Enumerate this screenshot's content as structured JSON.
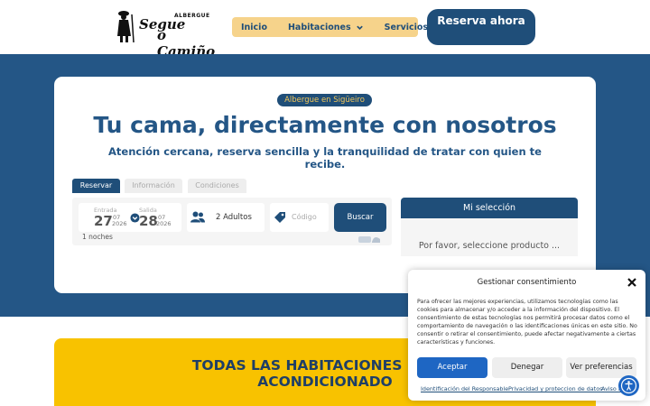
{
  "header": {
    "logo_line1": "Segue",
    "logo_small": "ALBERGUE",
    "logo_line2": "o Camiño",
    "nav": [
      {
        "label": "Inicio"
      },
      {
        "label": "Habitaciones"
      },
      {
        "label": "Servicios"
      }
    ],
    "reserve_button": "Reserva ahora"
  },
  "hero": {
    "badge": "Albergue en Sigüeiro",
    "title": "Tu cama, directamente con nosotros",
    "subtitle": "Atención cercana, reserva sencilla y la tranquilidad de tratar con quien te recibe."
  },
  "booking": {
    "tabs": [
      "Reservar",
      "Información",
      "Condiciones"
    ],
    "checkin": {
      "label": "Entrada",
      "day": "27",
      "month": "07",
      "year": "2026"
    },
    "checkout": {
      "label": "Salida",
      "day": "28",
      "month": "07",
      "year": "2026"
    },
    "guests": "2 Adultos",
    "code_placeholder": "Código",
    "search_button": "Buscar",
    "nights": "1 noches"
  },
  "selection": {
    "title": "Mi selección",
    "empty_text": "Por favor, seleccione producto ..."
  },
  "banner": {
    "line1": "TODAS LAS HABITACIONES DISPO",
    "line2": "ACONDICIONADO"
  },
  "cookie": {
    "title": "Gestionar consentimiento",
    "text": "Para ofrecer las mejores experiencias, utilizamos tecnologías como las cookies para almacenar y/o acceder a la información del dispositivo. El consentimiento de estas tecnologías nos permitirá procesar datos como el comportamiento de navegación o las identificaciones únicas en este sitio. No consentir o retirar el consentimiento, puede afectar negativamente a ciertas características y funciones.",
    "accept": "Aceptar",
    "deny": "Denegar",
    "preferences": "Ver preferencias",
    "links": [
      "Identificación del Responsable",
      "Privacidad y proteccion de datos",
      "Aviso le"
    ]
  },
  "colors": {
    "primary": "#1f4e79",
    "hero_band": "#245686",
    "nav_bg": "#f6d38b",
    "banner": "#f8c200",
    "cookie_accept": "#1e66c3"
  }
}
